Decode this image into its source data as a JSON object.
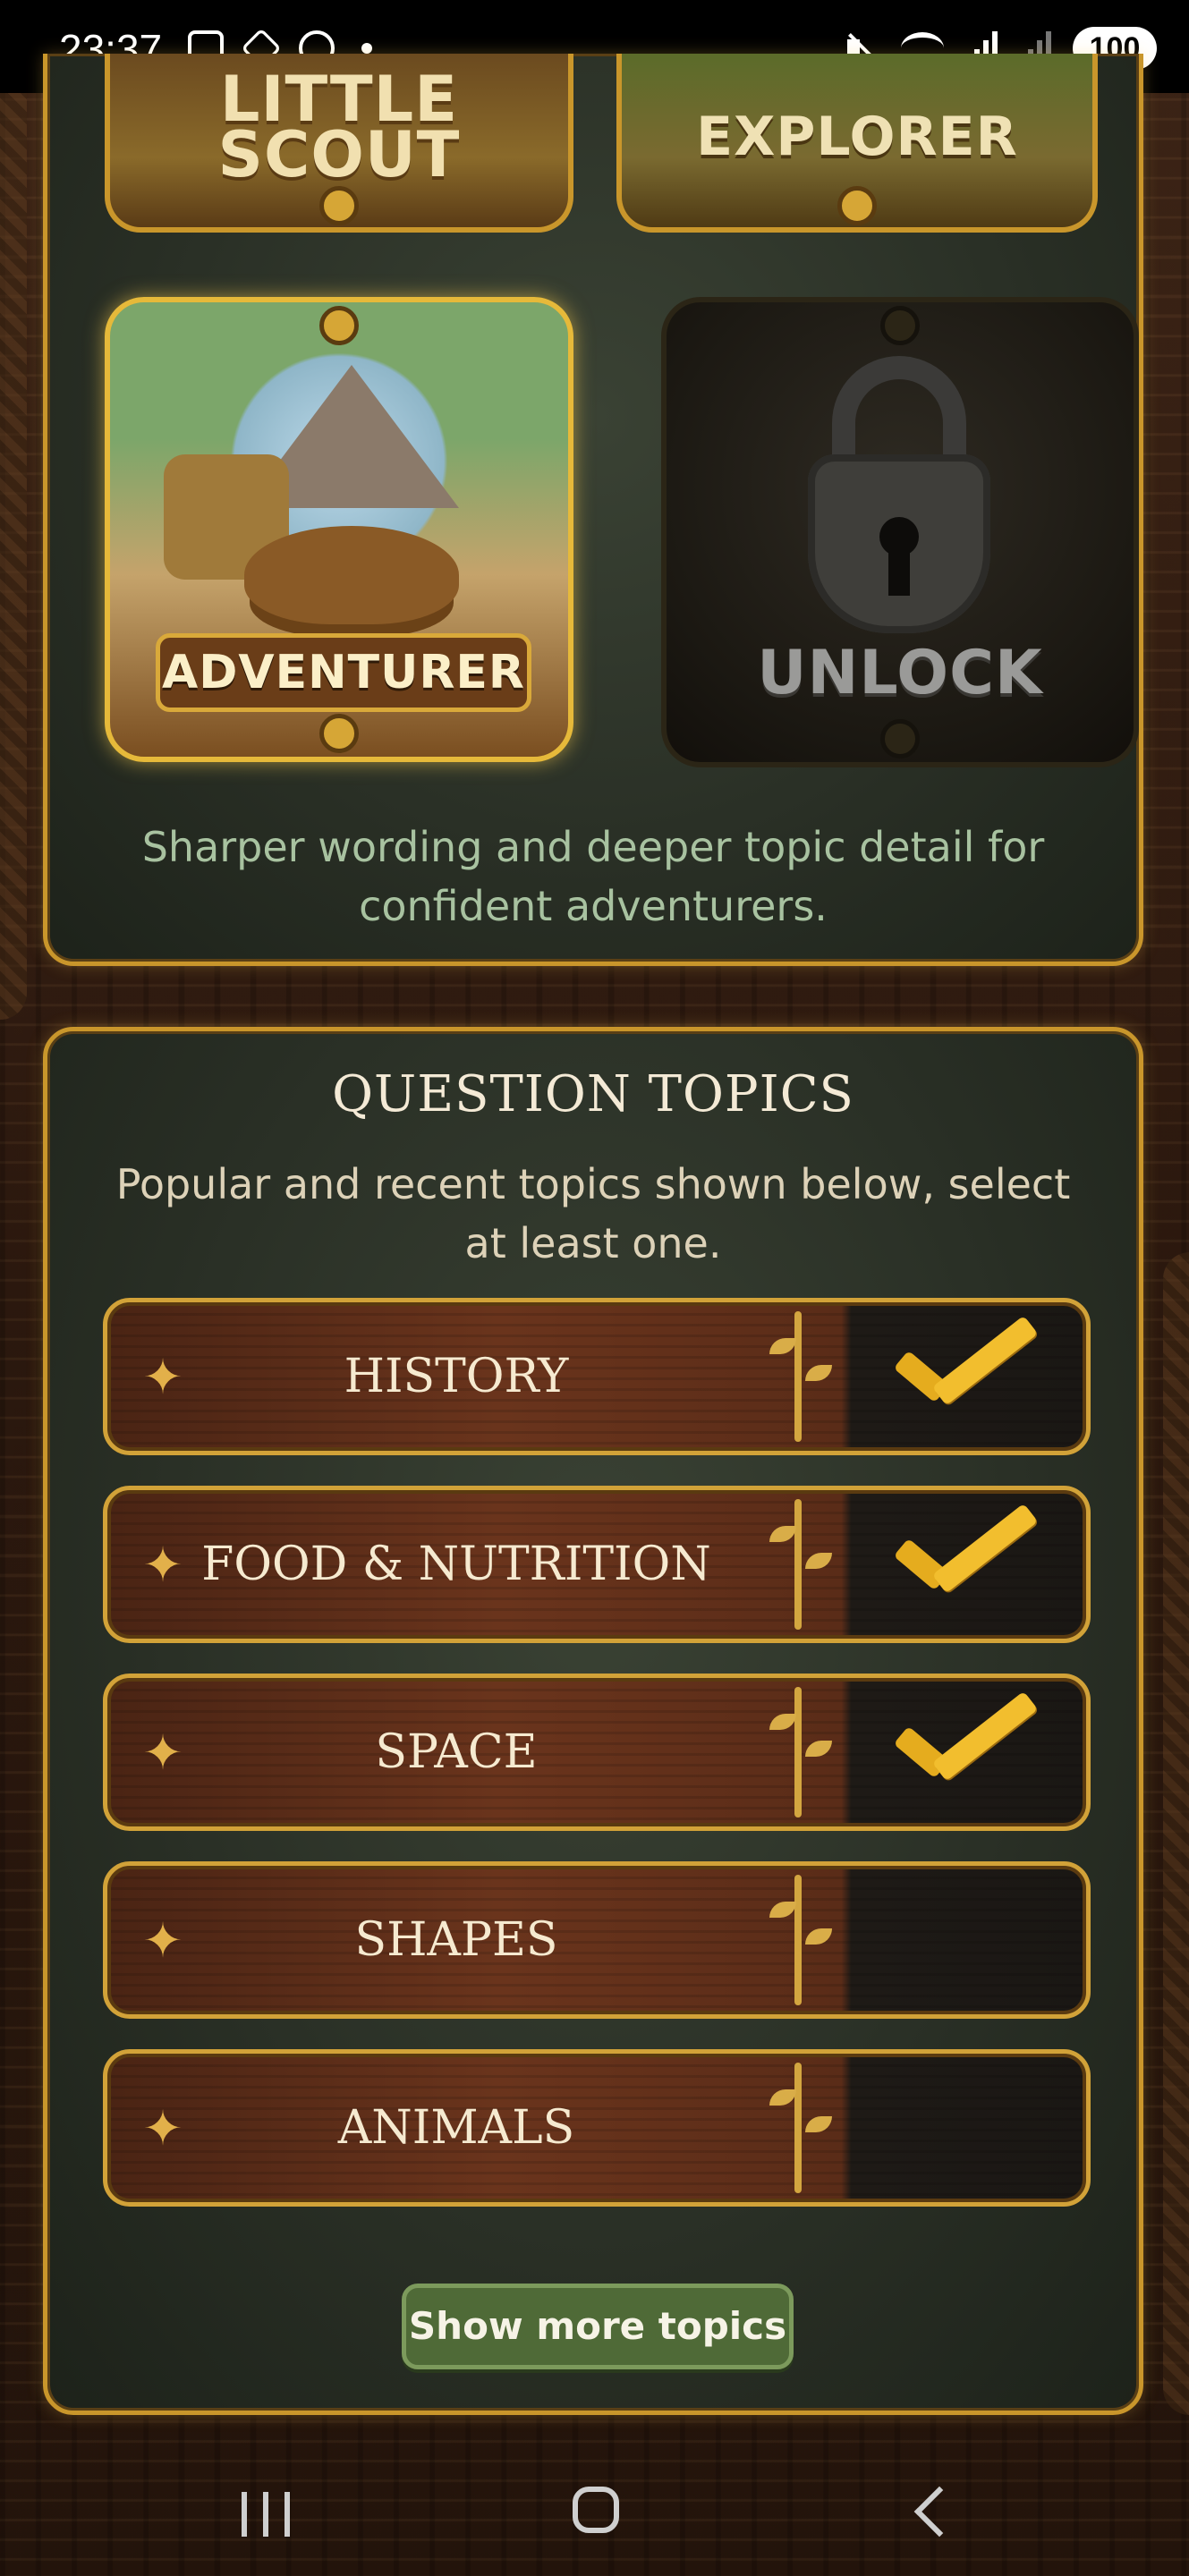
{
  "status_bar": {
    "time": "23:37",
    "battery": "100",
    "icons": [
      "screenshot-icon",
      "accessibility-icon",
      "alarm-icon",
      "notification-dot-icon",
      "mute-icon",
      "wifi-icon",
      "signal-icon",
      "signal-icon"
    ]
  },
  "levels": {
    "scout_label_line1": "LITTLE",
    "scout_label_line2": "SCOUT",
    "explorer_label": "EXPLORER",
    "adventurer_label": "ADVENTURER",
    "locked_label": "UNLOCK",
    "selected": "ADVENTURER",
    "description": "Sharper wording and deeper topic detail for confident adventurers."
  },
  "topics_section": {
    "title": "QUESTION TOPICS",
    "subtitle": "Popular and recent topics shown below, select at least one.",
    "items": [
      {
        "label": "HISTORY",
        "selected": true
      },
      {
        "label": "FOOD & NUTRITION",
        "selected": true
      },
      {
        "label": "SPACE",
        "selected": true
      },
      {
        "label": "SHAPES",
        "selected": false
      },
      {
        "label": "ANIMALS",
        "selected": false
      }
    ],
    "more_button": "Show more topics"
  },
  "colors": {
    "accent_gold": "#c9962b",
    "panel_green": "#2a3026",
    "button_green": "#4f6a37",
    "check_gold": "#f2be2e"
  }
}
